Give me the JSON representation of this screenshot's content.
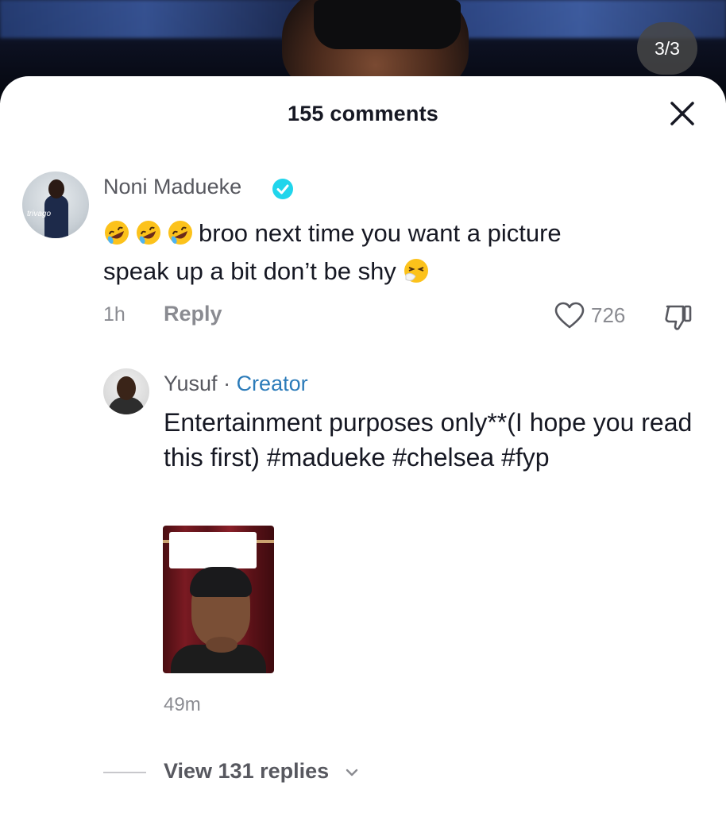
{
  "header": {
    "counter": "3/3"
  },
  "sheet": {
    "title": "155 comments"
  },
  "comment": {
    "author": "Noni Madueke",
    "verified": true,
    "text_line1": "broo next time you want a picture",
    "text_line2": "speak up a bit don’t be shy",
    "time": "1h",
    "reply_label": "Reply",
    "likes": "726"
  },
  "reply": {
    "author": "Yusuf",
    "separator": " · ",
    "tag": "Creator",
    "text": " Entertainment purposes only**(I hope you read this first) #madueke #chelsea #fyp",
    "time": "49m"
  },
  "footer": {
    "view_replies": "View 131 replies"
  },
  "colors": {
    "primary_text": "#161823",
    "secondary_text": "#8a8b91",
    "creator_accent": "#2b7bb9",
    "verified_badge": "#20d5ec"
  },
  "icons": [
    "close-icon",
    "verified-icon",
    "rofl-emoji-icon",
    "sneezing-emoji-icon",
    "heart-icon",
    "dislike-icon",
    "chevron-down-icon"
  ]
}
